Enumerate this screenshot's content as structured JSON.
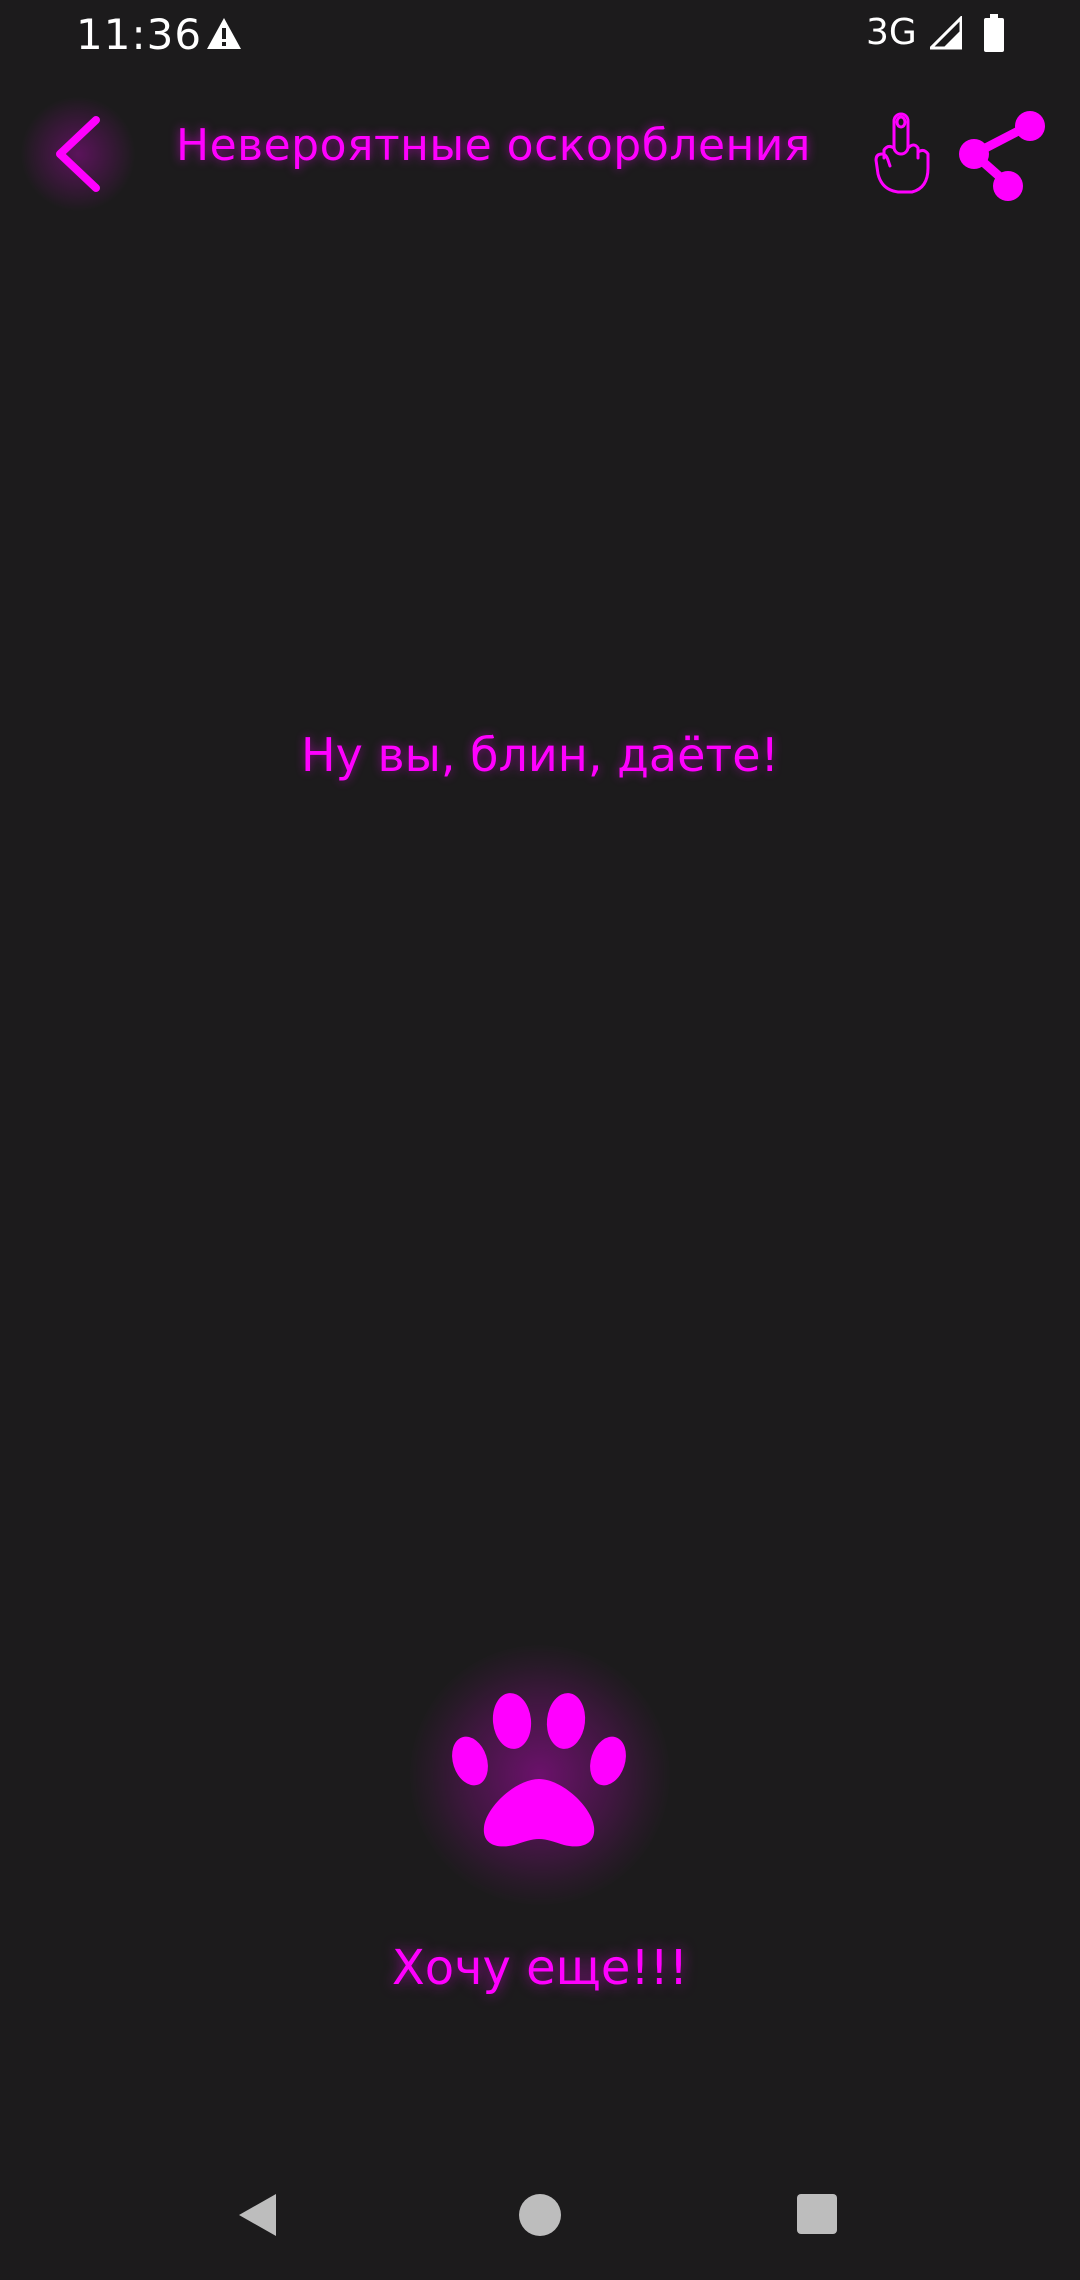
{
  "status_bar": {
    "time": "11:36",
    "network": "3G",
    "warning_icon": "warning-icon",
    "signal_icon": "signal-icon",
    "battery_icon": "battery-icon"
  },
  "toolbar": {
    "title": "Невероятные оскорбления",
    "back_icon": "chevron-left-icon",
    "title_icon": "middle-finger-icon",
    "share_icon": "share-icon"
  },
  "content": {
    "insult": "Ну вы, блин, даёте!",
    "paw_icon": "paw-icon",
    "more_label": "Хочу еще!!!"
  },
  "nav_bar": {
    "back_icon": "nav-back-icon",
    "home_icon": "nav-home-icon",
    "recents_icon": "nav-recents-icon"
  },
  "colors": {
    "background": "#1c1b1c",
    "accent": "#ff00ff",
    "status_text": "#ffffff",
    "nav_icons": "#bdbdbd"
  }
}
